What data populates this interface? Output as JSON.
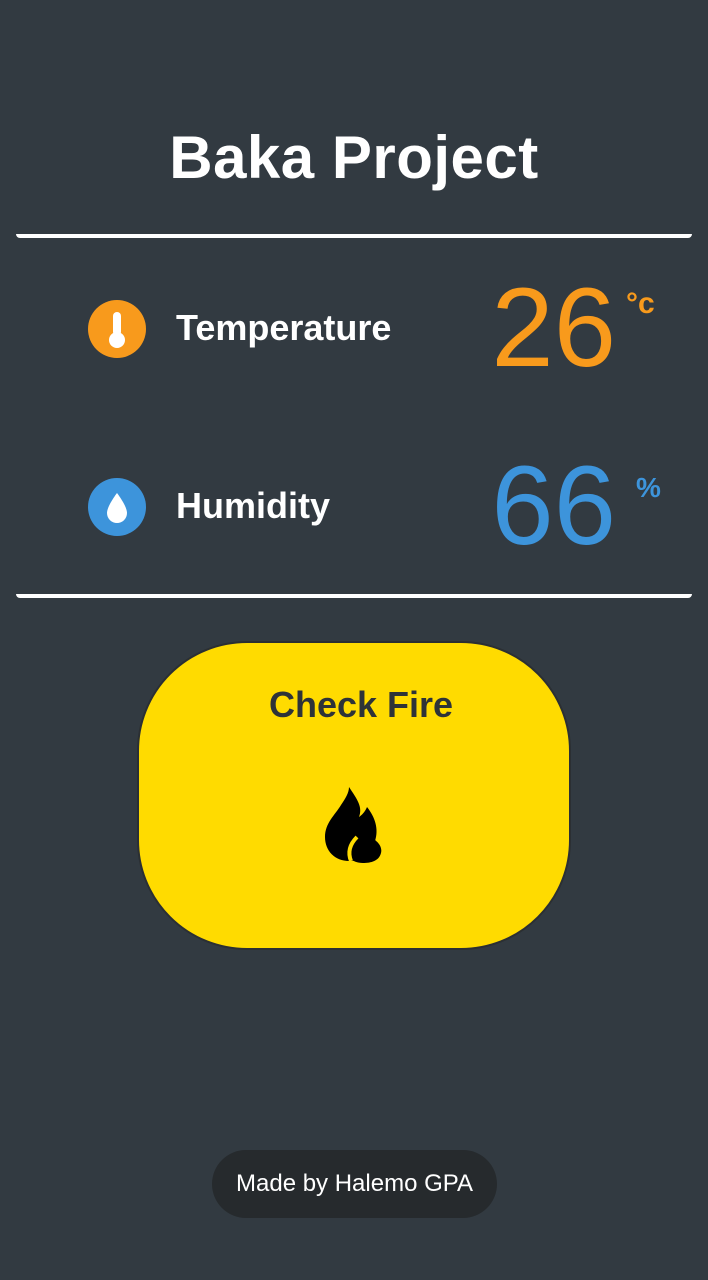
{
  "app": {
    "title": "Baka Project"
  },
  "readings": {
    "temperature": {
      "label": "Temperature",
      "value": "26",
      "unit": "°c",
      "icon": "thermometer-icon",
      "color": "#f89a1c"
    },
    "humidity": {
      "label": "Humidity",
      "value": "66",
      "unit": "%",
      "icon": "water-drop-icon",
      "color": "#3d94db"
    }
  },
  "fire_button": {
    "label": "Check Fire",
    "icon": "flame-icon",
    "color": "#ffdb00"
  },
  "footer": {
    "text": "Made by Halemo GPA"
  },
  "colors": {
    "background": "#323a41",
    "divider": "#ffffff",
    "footer_bg": "#262a2d"
  }
}
